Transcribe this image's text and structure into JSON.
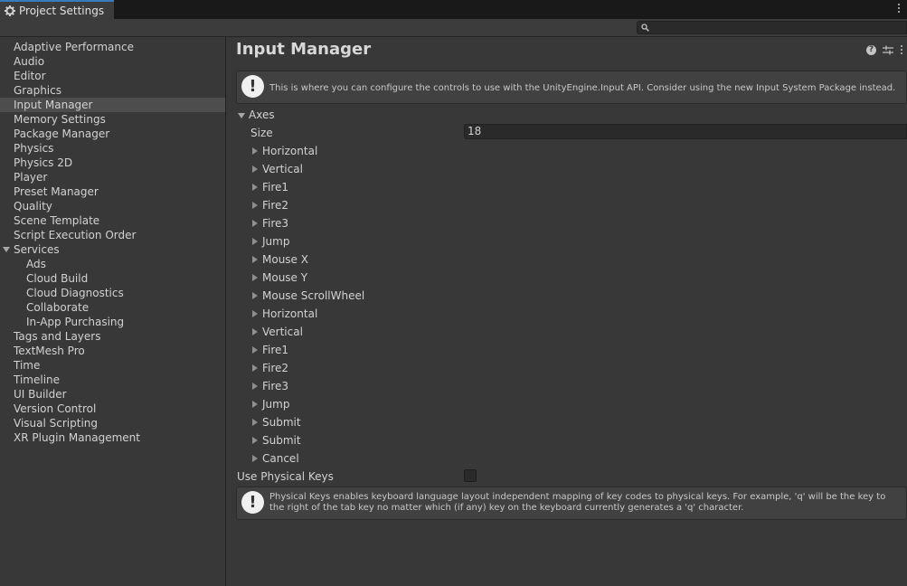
{
  "window": {
    "tab_title": "Project Settings"
  },
  "search": {
    "placeholder": ""
  },
  "sidebar": {
    "items": [
      "Adaptive Performance",
      "Audio",
      "Editor",
      "Graphics",
      "Input Manager",
      "Memory Settings",
      "Package Manager",
      "Physics",
      "Physics 2D",
      "Player",
      "Preset Manager",
      "Quality",
      "Scene Template",
      "Script Execution Order",
      "Services",
      "Tags and Layers",
      "TextMesh Pro",
      "Time",
      "Timeline",
      "UI Builder",
      "Version Control",
      "Visual Scripting",
      "XR Plugin Management"
    ],
    "services_children": [
      "Ads",
      "Cloud Build",
      "Cloud Diagnostics",
      "Collaborate",
      "In-App Purchasing"
    ],
    "selected": "Input Manager"
  },
  "main": {
    "title": "Input Manager",
    "info_text": "This is where you can configure the controls to use with the UnityEngine.Input API. Consider using the new Input System Package instead.",
    "axes_label": "Axes",
    "size_label": "Size",
    "size_value": "18",
    "axes": [
      "Horizontal",
      "Vertical",
      "Fire1",
      "Fire2",
      "Fire3",
      "Jump",
      "Mouse X",
      "Mouse Y",
      "Mouse ScrollWheel",
      "Horizontal",
      "Vertical",
      "Fire1",
      "Fire2",
      "Fire3",
      "Jump",
      "Submit",
      "Submit",
      "Cancel"
    ],
    "physical_keys_label": "Use Physical Keys",
    "physical_keys_checked": false,
    "physical_keys_help": "Physical Keys enables keyboard language layout independent mapping of key codes to physical keys. For example, 'q' will be the key to the right of the tab key no matter which (if any) key on the keyboard currently generates a 'q' character."
  },
  "colors": {
    "background": "#383838",
    "selected_item": "#4d4d4d",
    "tab_accent": "#3a79bb",
    "field": "#2a2a2a"
  }
}
